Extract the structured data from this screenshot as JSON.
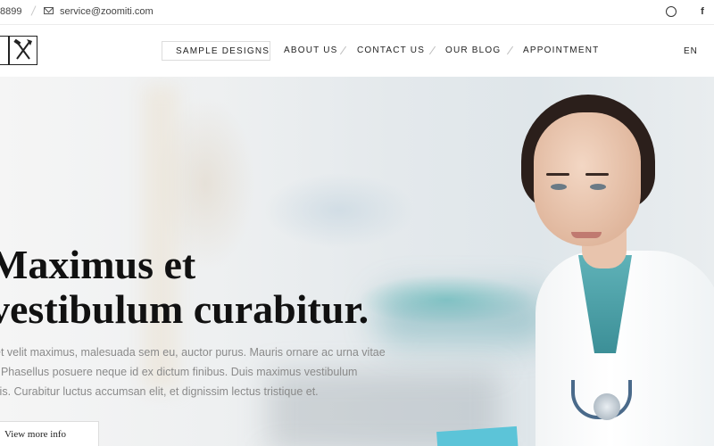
{
  "topbar": {
    "phone": "8899",
    "email": "service@zoomiti.com",
    "social": {
      "facebook": "f"
    },
    "icons": [
      "mail-icon",
      "dribbble-icon",
      "facebook-icon"
    ]
  },
  "header": {
    "logo_icon": "hammer-axe-icon",
    "nav": [
      {
        "label": "SAMPLE DESIGNS",
        "active": true
      },
      {
        "label": "ABOUT US"
      },
      {
        "label": "CONTACT US"
      },
      {
        "label": "OUR BLOG"
      },
      {
        "label": "APPOINTMENT"
      }
    ],
    "language": "EN"
  },
  "hero": {
    "headline_line1": "Maximus et",
    "headline_line2": "vestibulum curabitur.",
    "body": [
      "et velit maximus, malesuada sem eu, auctor purus. Mauris ornare ac urna vitae",
      ". Phasellus posuere neque id ex dictum finibus. Duis maximus vestibulum",
      "llis. Curabitur luctus accumsan elit, et dignissim lectus tristique et."
    ],
    "cta_label": "View more info"
  },
  "colors": {
    "text_dark": "#111111",
    "text_muted": "#8a8a8a",
    "accent_teal": "#5fb2b8"
  }
}
